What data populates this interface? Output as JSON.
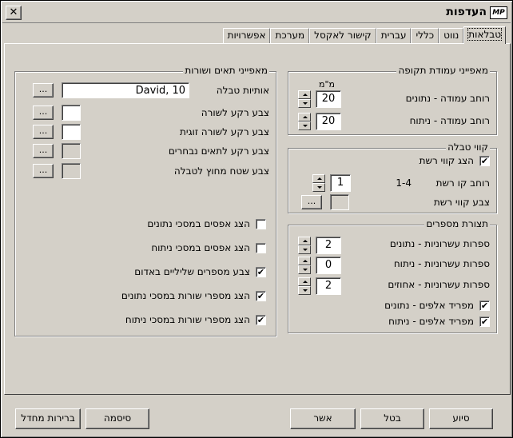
{
  "window": {
    "title": "העדפות",
    "app_icon": "MP",
    "close_glyph": "✕"
  },
  "tabs": [
    {
      "label": "טבלאות",
      "active": true
    },
    {
      "label": "נווט"
    },
    {
      "label": "כללי"
    },
    {
      "label": "עברית"
    },
    {
      "label": "קישור לאקסל"
    },
    {
      "label": "מערכת"
    },
    {
      "label": "אפשרויות"
    }
  ],
  "cells_group": {
    "title": "מאפייני תאים ושורות",
    "rows": [
      {
        "label": "אותיות טבלה",
        "value": "David, 10"
      },
      {
        "label": "צבע רקע לשורה",
        "color": "#ffffff"
      },
      {
        "label": "צבע רקע לשורה זוגית",
        "color": "#ffffff"
      },
      {
        "label": "צבע רקע לתאים נבחרים",
        "color": "#d4d0c8"
      },
      {
        "label": "צבע שטח מחוץ לטבלה",
        "color": "#d4d0c8"
      }
    ],
    "dots": "...",
    "checks": [
      {
        "label": "הצג אפסים במסכי נתונים",
        "checked": false
      },
      {
        "label": "הצג אפסים במסכי ניתוח",
        "checked": false
      },
      {
        "label": "צבע מספרים שליליים באדום",
        "checked": true
      },
      {
        "label": "הצג מספרי שורות במסכי נתונים",
        "checked": true
      },
      {
        "label": "הצג מספרי שורות במסכי ניתוח",
        "checked": true
      }
    ]
  },
  "period_group": {
    "title": "מאפייני עמודת תקופה",
    "unit": "מ\"מ",
    "rows": [
      {
        "label": "רוחב עמודה - נתונים",
        "value": "20"
      },
      {
        "label": "רוחב עמודה - ניתוח",
        "value": "20"
      }
    ]
  },
  "grid_group": {
    "title": "קווי טבלה",
    "show_grid": {
      "label": "הצג קווי רשת",
      "checked": true
    },
    "width": {
      "label": "רוחב קו רשת",
      "range": "1-4",
      "value": "1"
    },
    "color": {
      "label": "צבע קווי רשת",
      "color": "#d4d0c8"
    },
    "dots": "..."
  },
  "number_group": {
    "title": "תצורת מספרים",
    "rows": [
      {
        "label": "ספרות עשרוניות - נתונים",
        "value": "2"
      },
      {
        "label": "ספרות עשרוניות - ניתוח",
        "value": "0"
      },
      {
        "label": "ספרות עשרוניות - אחוזים",
        "value": "2"
      }
    ],
    "checks": [
      {
        "label": "מפריד אלפים - נתונים",
        "checked": true
      },
      {
        "label": "מפריד אלפים - ניתוח",
        "checked": true
      }
    ]
  },
  "buttons": {
    "defaults": "ברירות מחדל",
    "password": "סיסמה",
    "ok": "אשר",
    "cancel": "בטל",
    "help": "סיוע"
  },
  "check_glyph": "✔"
}
